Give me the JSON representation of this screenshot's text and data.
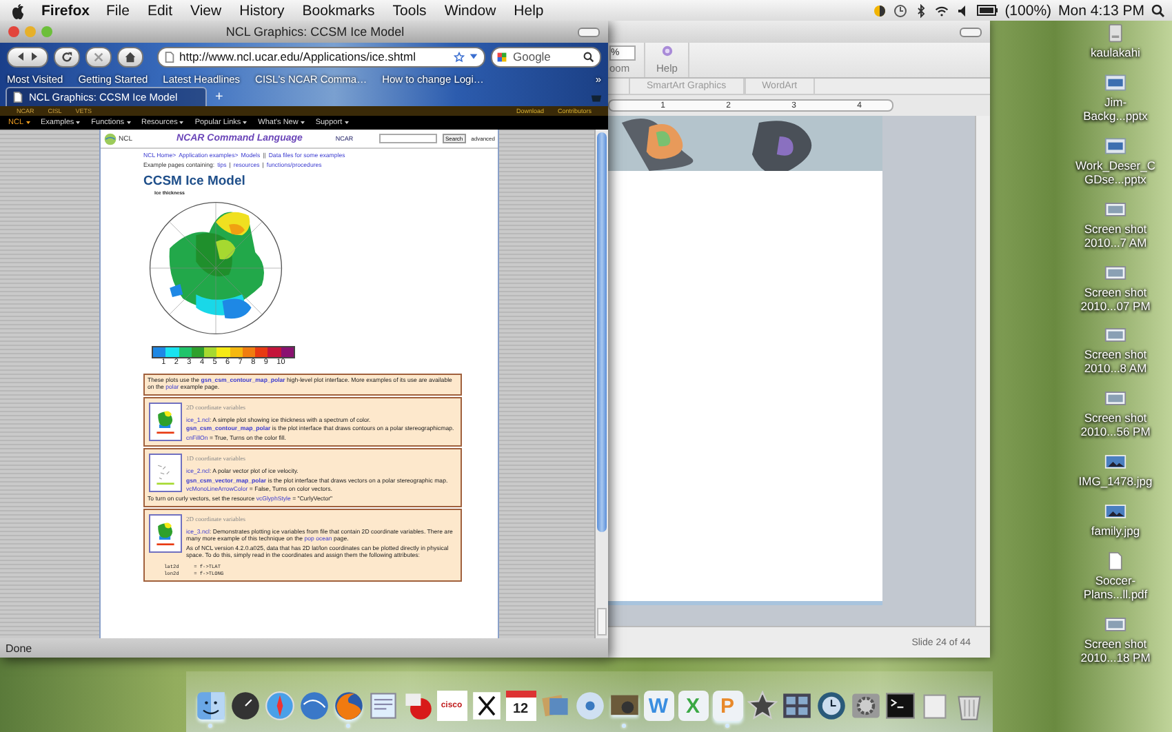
{
  "menubar": {
    "app": "Firefox",
    "menus": [
      "File",
      "Edit",
      "View",
      "History",
      "Bookmarks",
      "Tools",
      "Window",
      "Help"
    ],
    "battery": "(100%)",
    "clock": "Mon 4:13 PM"
  },
  "ppt": {
    "zoom_field": "%",
    "zoom_label": "oom",
    "help": "Help",
    "tabs": [
      "SmartArt Graphics",
      "WordArt"
    ],
    "ruler": [
      "1",
      "2",
      "3",
      "4"
    ],
    "status": "Slide 24 of 44"
  },
  "browser": {
    "title": "NCL Graphics: CCSM Ice Model",
    "url": "http://www.ncl.ucar.edu/Applications/ice.shtml",
    "search_placeholder": "Google",
    "bookmarks": [
      "Most Visited",
      "Getting Started",
      "Latest Headlines",
      "CISL's NCAR Comma…",
      "How to change Logi…"
    ],
    "bookmarks_more": "»",
    "tab": {
      "label": "NCL Graphics: CCSM Ice Model",
      "selected": true
    },
    "new_tab": "+",
    "top_links": [
      "NCAR",
      "CISL",
      "VETS"
    ],
    "top_right_links": [
      "Download",
      "Contributors"
    ],
    "nav": [
      {
        "label": "NCL",
        "selected": true
      },
      {
        "label": "Examples",
        "selected": false
      },
      {
        "label": "Functions",
        "selected": false
      },
      {
        "label": "Resources",
        "selected": false
      },
      {
        "label": "Popular Links",
        "selected": false
      },
      {
        "label": "What's New",
        "selected": false
      },
      {
        "label": "Support",
        "selected": false
      }
    ],
    "status": "Done",
    "page": {
      "logo": "NCL",
      "title": "NCAR Command Language",
      "org": "NCAR",
      "search_button": "Search",
      "advanced": "advanced",
      "breadcrumb": [
        {
          "kind": "link",
          "text": "NCL Home>"
        },
        {
          "kind": "link",
          "text": "Application examples>"
        },
        {
          "kind": "link",
          "text": "Models"
        },
        {
          "kind": "sep",
          "text": "||"
        },
        {
          "kind": "link",
          "text": "Data files for some examples"
        }
      ],
      "examples_line": [
        {
          "kind": "text",
          "text": "Example pages containing:"
        },
        {
          "kind": "link",
          "text": "tips"
        },
        {
          "kind": "sep",
          "text": "|"
        },
        {
          "kind": "link",
          "text": "resources"
        },
        {
          "kind": "sep",
          "text": "|"
        },
        {
          "kind": "link",
          "text": "functions/procedures"
        }
      ],
      "heading": "CCSM Ice Model",
      "map_title": "Ice thickness",
      "colorbar": {
        "swatches": [
          {
            "color": "#1e88e5"
          },
          {
            "color": "#19e3f0"
          },
          {
            "color": "#1fc46a"
          },
          {
            "color": "#2ea02c"
          },
          {
            "color": "#a6d930"
          },
          {
            "color": "#f5ea14"
          },
          {
            "color": "#f5b80f"
          },
          {
            "color": "#f07d10"
          },
          {
            "color": "#e83a12"
          },
          {
            "color": "#c4143a"
          },
          {
            "color": "#8a1170"
          }
        ],
        "labels": [
          "1",
          "2",
          "3",
          "4",
          "5",
          "6",
          "7",
          "8",
          "9",
          "10"
        ]
      },
      "intro": [
        {
          "kind": "text",
          "text": "These plots use the "
        },
        {
          "kind": "bold_link",
          "text": "gsn_csm_contour_map_polar"
        },
        {
          "kind": "text",
          "text": " high-level plot interface. More examples of its use are available on the "
        },
        {
          "kind": "link",
          "text": "polar"
        },
        {
          "kind": "text",
          "text": " example page."
        }
      ],
      "boxes": [
        {
          "kind": "contour",
          "heading": "2D coordinate variables",
          "paragraphs": [
            [
              {
                "kind": "link",
                "text": "ice_1.ncl"
              },
              {
                "kind": "text",
                "text": ": A simple plot showing ice thickness with a spectrum of color."
              }
            ],
            [
              {
                "kind": "bold_link",
                "text": "gsn_csm_contour_map_polar"
              },
              {
                "kind": "text",
                "text": " is the plot interface that draws contours on a polar stereographicmap."
              }
            ],
            [
              {
                "kind": "link",
                "text": "cnFillOn"
              },
              {
                "kind": "text",
                "text": " = True, Turns on the color fill."
              }
            ]
          ]
        },
        {
          "kind": "vector",
          "heading": "1D coordinate variables",
          "paragraphs": [
            [
              {
                "kind": "link",
                "text": "ice_2.ncl"
              },
              {
                "kind": "text",
                "text": ": A polar vector plot of ice velocity."
              }
            ],
            [
              {
                "kind": "bold_link",
                "text": "gsn_csm_vector_map_polar"
              },
              {
                "kind": "text",
                "text": " is the plot interface that draws vectors on a polar stereographic map."
              }
            ],
            [
              {
                "kind": "link",
                "text": "vcMonoLineArrowColor"
              },
              {
                "kind": "text",
                "text": " = False, Turns on color vectors."
              }
            ],
            [
              {
                "kind": "text",
                "text": "To turn on curly vectors, set the resource "
              },
              {
                "kind": "link",
                "text": "vcGlyphStyle"
              },
              {
                "kind": "text",
                "text": " = \"CurlyVector\""
              }
            ]
          ]
        },
        {
          "kind": "contour",
          "heading": "2D coordinate variables",
          "paragraphs": [
            [
              {
                "kind": "link",
                "text": "ice_3.ncl"
              },
              {
                "kind": "text",
                "text": ": Demonstrates plotting ice variables from file that contain 2D coordinate variables. There are many more example of this technique on the "
              },
              {
                "kind": "link",
                "text": "pop ocean"
              },
              {
                "kind": "text",
                "text": " page."
              }
            ],
            [
              {
                "kind": "text",
                "text": "As of NCL version 4.2.0.a025, data that has 2D lat/lon coordinates can be plotted directly in physical space. To do this, simply read in the coordinates and assign them the following attributes:"
              }
            ]
          ],
          "code": [
            "lat2d     = f->TLAT",
            "lon2d     = f->TLONG"
          ]
        }
      ]
    }
  },
  "desktop": [
    {
      "kind": "drive",
      "lines": [
        "kaulakahi"
      ]
    },
    {
      "kind": "slide",
      "lines": [
        "Jim-",
        "Backg...pptx"
      ]
    },
    {
      "kind": "slide",
      "lines": [
        "Work_Deser_C",
        "GDse...pptx"
      ]
    },
    {
      "kind": "shot",
      "lines": [
        "Screen shot",
        "2010...7 AM"
      ]
    },
    {
      "kind": "shot",
      "lines": [
        "Screen shot",
        "2010...07 PM"
      ]
    },
    {
      "kind": "shot",
      "lines": [
        "Screen shot",
        "2010...8 AM"
      ]
    },
    {
      "kind": "shot",
      "lines": [
        "Screen shot",
        "2010...56 PM"
      ]
    },
    {
      "kind": "photo",
      "lines": [
        "IMG_1478.jpg"
      ]
    },
    {
      "kind": "photo",
      "lines": [
        "family.jpg"
      ]
    },
    {
      "kind": "doc",
      "lines": [
        "Soccer-",
        "Plans...ll.pdf"
      ]
    },
    {
      "kind": "shot",
      "lines": [
        "Screen shot",
        "2010...18 PM"
      ]
    }
  ],
  "dock": [
    {
      "kind": "face",
      "running": true
    },
    {
      "kind": "gauge",
      "running": false
    },
    {
      "kind": "compass",
      "running": false
    },
    {
      "kind": "globe",
      "running": false
    },
    {
      "kind": "fox",
      "running": true
    },
    {
      "kind": "sheet",
      "running": false
    },
    {
      "kind": "ball",
      "running": false
    },
    {
      "kind": "bars",
      "running": false,
      "glyph": "cisco"
    },
    {
      "kind": "cross",
      "running": false
    },
    {
      "kind": "calendar",
      "running": false,
      "glyph": "12"
    },
    {
      "kind": "photos",
      "running": false
    },
    {
      "kind": "disc",
      "running": false
    },
    {
      "kind": "camera",
      "running": true
    },
    {
      "kind": "letter",
      "running": false,
      "glyph": "W",
      "color": "#3a8ee0"
    },
    {
      "kind": "letter",
      "running": false,
      "glyph": "X",
      "color": "#3aa844"
    },
    {
      "kind": "letter",
      "running": true,
      "glyph": "P",
      "color": "#e8892a"
    },
    {
      "kind": "star",
      "running": false
    },
    {
      "kind": "windows",
      "running": false
    },
    {
      "kind": "clock",
      "running": false
    },
    {
      "kind": "gear",
      "running": false
    },
    {
      "kind": "terminal",
      "running": false
    },
    {
      "kind": "doc",
      "running": false
    },
    {
      "kind": "trash",
      "running": false
    }
  ]
}
